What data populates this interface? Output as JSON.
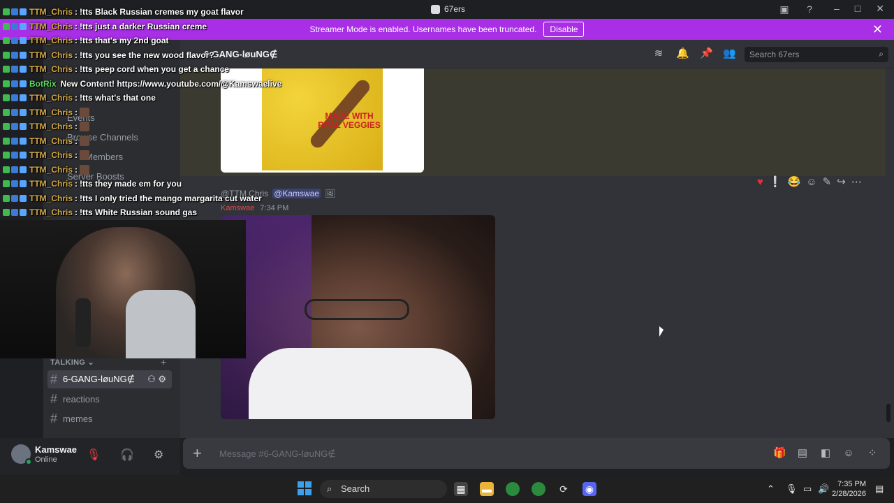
{
  "window": {
    "title": "67ers"
  },
  "streamer_banner": {
    "text": "Streamer Mode is enabled. Usernames have been truncated.",
    "disable_label": "Disable"
  },
  "channel_header": {
    "name": "6-GANG-løuNG∉",
    "search_placeholder": "Search 67ers"
  },
  "sidebar": {
    "overlapped_items": [
      "Events",
      "Browse Channels",
      "Members",
      "Server Boosts"
    ],
    "category": "TALKING",
    "channels": [
      {
        "label": "6-GANG-løuNG∉",
        "active": true
      },
      {
        "label": "reactions",
        "active": false
      },
      {
        "label": "memes",
        "active": false
      }
    ]
  },
  "message": {
    "reply_user": "@TTM Chris",
    "reply_mention": "@Kamswae",
    "author": "Kamswae",
    "timestamp": "7:34 PM",
    "snack_text": "MADE WITH REAL VEGGIES"
  },
  "composer": {
    "placeholder": "Message #6-GANG-løuNG∉"
  },
  "user_panel": {
    "name": "Kamswae",
    "status": "Online"
  },
  "taskbar": {
    "search_label": "Search",
    "time": "7:35 PM",
    "date": "2/28/2026"
  },
  "overlay_chat": [
    {
      "nick": "TTM_Chris",
      "text": "!tts Black Russian cremes my goat flavor"
    },
    {
      "nick": "TTM_Chris",
      "text": "!tts just a darker Russian creme"
    },
    {
      "nick": "TTM_Chris",
      "text": "!tts that's my 2nd goat"
    },
    {
      "nick": "TTM_Chris",
      "text": "!tts you see the new wood flavor?"
    },
    {
      "nick": "TTM_Chris",
      "text": "!tts peep cord when you get a chance"
    },
    {
      "nick": "BotRix",
      "text": "New Content! https://www.youtube.com/@Kamswaelive"
    },
    {
      "nick": "TTM_Chris",
      "text": "!tts what's that one"
    },
    {
      "nick": "TTM_Chris",
      "text": ""
    },
    {
      "nick": "TTM_Chris",
      "text": ""
    },
    {
      "nick": "TTM_Chris",
      "text": ""
    },
    {
      "nick": "TTM_Chris",
      "text": ""
    },
    {
      "nick": "TTM_Chris",
      "text": ""
    },
    {
      "nick": "TTM_Chris",
      "text": "!tts they made em for you"
    },
    {
      "nick": "TTM_Chris",
      "text": "!tts I only tried the mango margarita cut water"
    },
    {
      "nick": "TTM_Chris",
      "text": "!tts White Russian sound gas"
    }
  ],
  "colors": {
    "streamer_banner": "#a82fe6",
    "accent": "#5865f2",
    "online": "#23a55a",
    "author": "#e04b4b"
  }
}
